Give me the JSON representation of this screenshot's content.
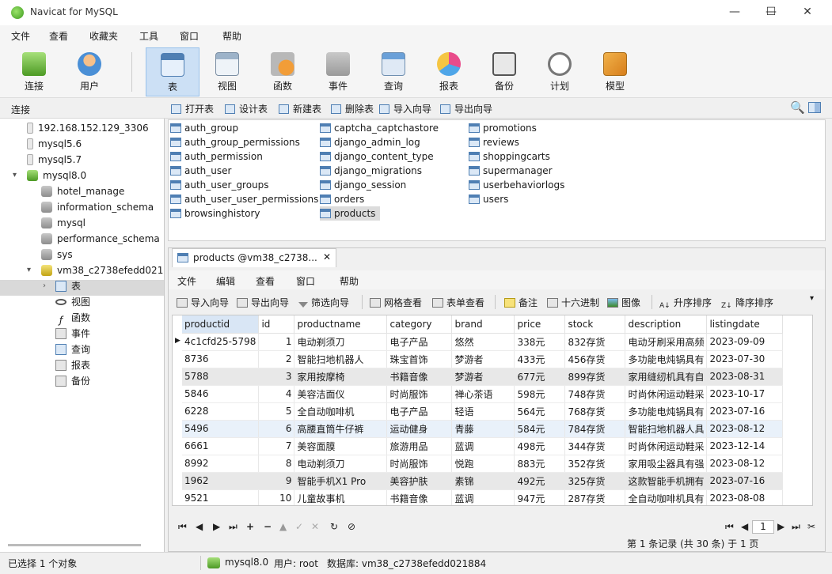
{
  "app": {
    "title": "Navicat for MySQL"
  },
  "window_controls": {
    "minimize": "—",
    "maximize": "☐",
    "close": "✕"
  },
  "menu": [
    "文件",
    "查看",
    "收藏夹",
    "工具",
    "窗口",
    "帮助"
  ],
  "toolbar": [
    "连接",
    "用户",
    "表",
    "视图",
    "函数",
    "事件",
    "查询",
    "报表",
    "备份",
    "计划",
    "模型"
  ],
  "conn_label": "连接",
  "object_toolbar": [
    "打开表",
    "设计表",
    "新建表",
    "删除表",
    "导入向导",
    "导出向导"
  ],
  "tree": {
    "connections": [
      "192.168.152.129_3306",
      "mysql5.6",
      "mysql5.7",
      "mysql8.0"
    ],
    "databases": [
      "hotel_manage",
      "information_schema",
      "mysql",
      "performance_schema",
      "sys",
      "vm38_c2738efedd021884"
    ],
    "db_children": [
      "表",
      "视图",
      "函数",
      "事件",
      "查询",
      "报表",
      "备份"
    ]
  },
  "tables": [
    "auth_group",
    "auth_group_permissions",
    "auth_permission",
    "auth_user",
    "auth_user_groups",
    "auth_user_user_permissions",
    "browsinghistory",
    "captcha_captchastore",
    "django_admin_log",
    "django_content_type",
    "django_migrations",
    "django_session",
    "orders",
    "products",
    "promotions",
    "reviews",
    "shoppingcarts",
    "supermanager",
    "userbehaviorlogs",
    "users"
  ],
  "tab": {
    "title": "products @vm38_c2738...",
    "close": "✕"
  },
  "inner_menu": [
    "文件",
    "编辑",
    "查看",
    "窗口",
    "帮助"
  ],
  "inner_toolbar": [
    "导入向导",
    "导出向导",
    "筛选向导",
    "网格查看",
    "表单查看",
    "备注",
    "十六进制",
    "图像",
    "升序排序",
    "降序排序"
  ],
  "grid": {
    "columns": [
      "productid",
      "id",
      "productname",
      "category",
      "brand",
      "price",
      "stock",
      "description",
      "listingdate"
    ],
    "rows": [
      [
        "4c1cfd25-5798",
        "1",
        "电动剃须刀",
        "电子产品",
        "悠然",
        "338元",
        "832存货",
        "电动牙刷采用高频",
        "2023-09-09"
      ],
      [
        "8736",
        "2",
        "智能扫地机器人",
        "珠宝首饰",
        "梦游者",
        "433元",
        "456存货",
        "多功能电炖锅具有",
        "2023-07-30"
      ],
      [
        "5788",
        "3",
        "家用按摩椅",
        "书籍音像",
        "梦游者",
        "677元",
        "899存货",
        "家用缝纫机具有自",
        "2023-08-31"
      ],
      [
        "5846",
        "4",
        "美容洁面仪",
        "时尚服饰",
        "禅心茶语",
        "598元",
        "748存货",
        "时尚休闲运动鞋采",
        "2023-10-17"
      ],
      [
        "6228",
        "5",
        "全自动咖啡机",
        "电子产品",
        "轻语",
        "564元",
        "768存货",
        "多功能电炖锅具有",
        "2023-07-16"
      ],
      [
        "5496",
        "6",
        "高腰直筒牛仔裤",
        "运动健身",
        "青藤",
        "584元",
        "784存货",
        "智能扫地机器人具",
        "2023-08-12"
      ],
      [
        "6661",
        "7",
        "美容面膜",
        "旅游用品",
        "蓝调",
        "498元",
        "344存货",
        "时尚休闲运动鞋采",
        "2023-12-14"
      ],
      [
        "8992",
        "8",
        "电动剃须刀",
        "时尚服饰",
        "悦跑",
        "883元",
        "352存货",
        "家用吸尘器具有强",
        "2023-08-12"
      ],
      [
        "1962",
        "9",
        "智能手机X1 Pro",
        "美容护肤",
        "素锦",
        "492元",
        "325存货",
        "这款智能手机拥有",
        "2023-07-16"
      ],
      [
        "9521",
        "10",
        "儿童故事机",
        "书籍音像",
        "蓝调",
        "947元",
        "287存货",
        "全自动咖啡机具有",
        "2023-08-08"
      ]
    ]
  },
  "navigator": {
    "page": "1"
  },
  "record_info": "第 1 条记录 (共 30 条) 于 1 页",
  "status": {
    "selected": "已选择 1 个对象",
    "connection": "mysql8.0",
    "user": "用户: root",
    "database": "数据库: vm38_c2738efedd021884"
  }
}
